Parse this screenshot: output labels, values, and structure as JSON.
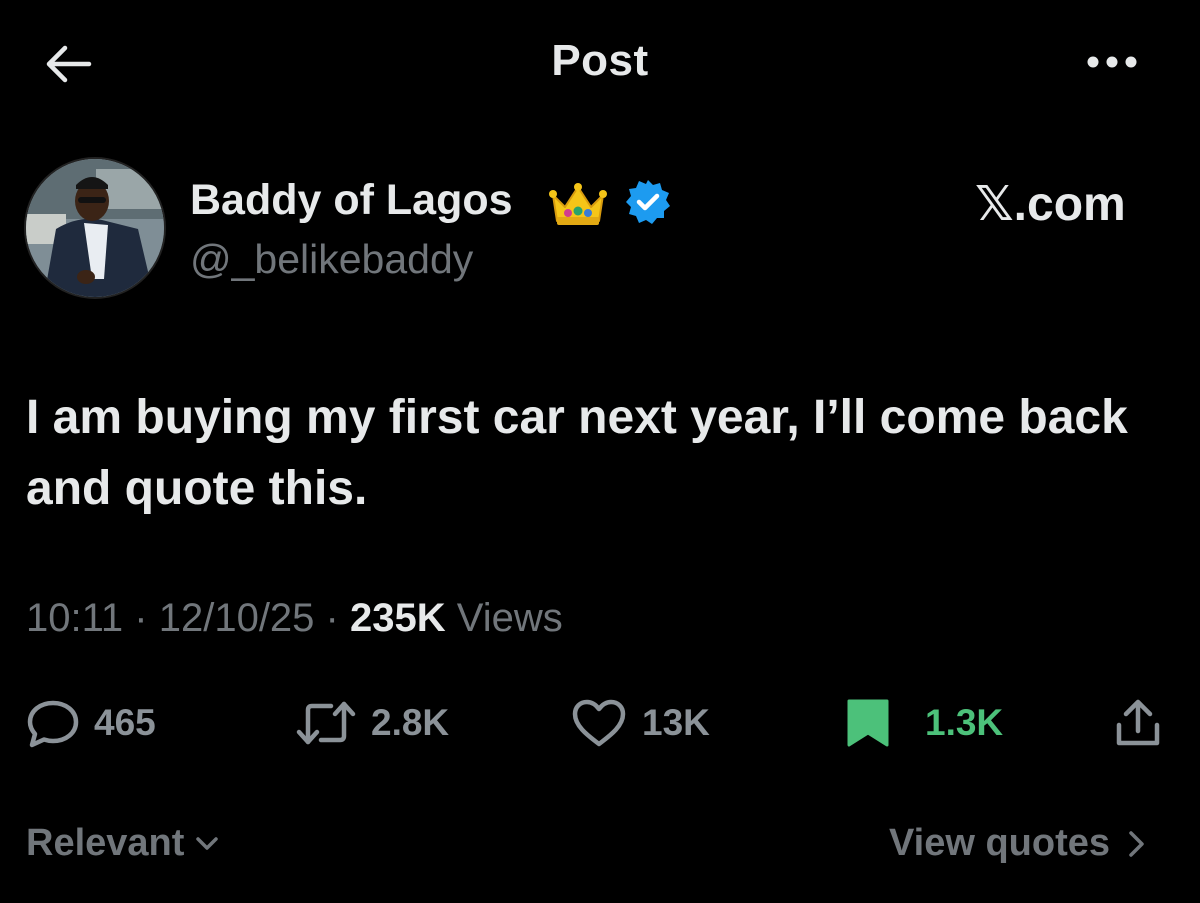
{
  "header": {
    "title": "Post",
    "back_icon": "arrow-left-icon",
    "more_icon": "more-horizontal-icon"
  },
  "author": {
    "display_name": "Baddy of Lagos",
    "handle": "@_belikebaddy",
    "emoji": "crown-emoji",
    "verified": true,
    "verified_color": "#1d9bf0"
  },
  "brand_label": "𝕏.com",
  "tweet": {
    "text": "I am buying my first car next year, I’ll come back  and quote this."
  },
  "meta": {
    "time": "10:11",
    "separator": "·",
    "date": "12/10/25",
    "views_count": "235K",
    "views_label": "Views"
  },
  "actions": {
    "reply_count": "465",
    "retweet_count": "2.8K",
    "like_count": "13K",
    "bookmark_count": "1.3K",
    "bookmark_active": true,
    "bookmark_color": "#4cc17a"
  },
  "footer": {
    "sort_label": "Relevant",
    "view_quotes_label": "View quotes"
  },
  "colors": {
    "background": "#000000",
    "text_primary": "#e7e9ea",
    "text_secondary": "#71767b"
  }
}
